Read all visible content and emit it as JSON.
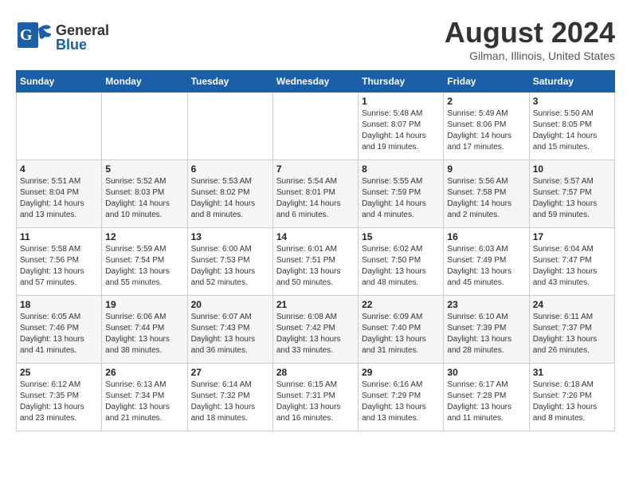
{
  "header": {
    "logo_general": "General",
    "logo_blue": "Blue",
    "month_title": "August 2024",
    "location": "Gilman, Illinois, United States"
  },
  "weekdays": [
    "Sunday",
    "Monday",
    "Tuesday",
    "Wednesday",
    "Thursday",
    "Friday",
    "Saturday"
  ],
  "weeks": [
    [
      {
        "day": "",
        "info": ""
      },
      {
        "day": "",
        "info": ""
      },
      {
        "day": "",
        "info": ""
      },
      {
        "day": "",
        "info": ""
      },
      {
        "day": "1",
        "info": "Sunrise: 5:48 AM\nSunset: 8:07 PM\nDaylight: 14 hours\nand 19 minutes."
      },
      {
        "day": "2",
        "info": "Sunrise: 5:49 AM\nSunset: 8:06 PM\nDaylight: 14 hours\nand 17 minutes."
      },
      {
        "day": "3",
        "info": "Sunrise: 5:50 AM\nSunset: 8:05 PM\nDaylight: 14 hours\nand 15 minutes."
      }
    ],
    [
      {
        "day": "4",
        "info": "Sunrise: 5:51 AM\nSunset: 8:04 PM\nDaylight: 14 hours\nand 13 minutes."
      },
      {
        "day": "5",
        "info": "Sunrise: 5:52 AM\nSunset: 8:03 PM\nDaylight: 14 hours\nand 10 minutes."
      },
      {
        "day": "6",
        "info": "Sunrise: 5:53 AM\nSunset: 8:02 PM\nDaylight: 14 hours\nand 8 minutes."
      },
      {
        "day": "7",
        "info": "Sunrise: 5:54 AM\nSunset: 8:01 PM\nDaylight: 14 hours\nand 6 minutes."
      },
      {
        "day": "8",
        "info": "Sunrise: 5:55 AM\nSunset: 7:59 PM\nDaylight: 14 hours\nand 4 minutes."
      },
      {
        "day": "9",
        "info": "Sunrise: 5:56 AM\nSunset: 7:58 PM\nDaylight: 14 hours\nand 2 minutes."
      },
      {
        "day": "10",
        "info": "Sunrise: 5:57 AM\nSunset: 7:57 PM\nDaylight: 13 hours\nand 59 minutes."
      }
    ],
    [
      {
        "day": "11",
        "info": "Sunrise: 5:58 AM\nSunset: 7:56 PM\nDaylight: 13 hours\nand 57 minutes."
      },
      {
        "day": "12",
        "info": "Sunrise: 5:59 AM\nSunset: 7:54 PM\nDaylight: 13 hours\nand 55 minutes."
      },
      {
        "day": "13",
        "info": "Sunrise: 6:00 AM\nSunset: 7:53 PM\nDaylight: 13 hours\nand 52 minutes."
      },
      {
        "day": "14",
        "info": "Sunrise: 6:01 AM\nSunset: 7:51 PM\nDaylight: 13 hours\nand 50 minutes."
      },
      {
        "day": "15",
        "info": "Sunrise: 6:02 AM\nSunset: 7:50 PM\nDaylight: 13 hours\nand 48 minutes."
      },
      {
        "day": "16",
        "info": "Sunrise: 6:03 AM\nSunset: 7:49 PM\nDaylight: 13 hours\nand 45 minutes."
      },
      {
        "day": "17",
        "info": "Sunrise: 6:04 AM\nSunset: 7:47 PM\nDaylight: 13 hours\nand 43 minutes."
      }
    ],
    [
      {
        "day": "18",
        "info": "Sunrise: 6:05 AM\nSunset: 7:46 PM\nDaylight: 13 hours\nand 41 minutes."
      },
      {
        "day": "19",
        "info": "Sunrise: 6:06 AM\nSunset: 7:44 PM\nDaylight: 13 hours\nand 38 minutes."
      },
      {
        "day": "20",
        "info": "Sunrise: 6:07 AM\nSunset: 7:43 PM\nDaylight: 13 hours\nand 36 minutes."
      },
      {
        "day": "21",
        "info": "Sunrise: 6:08 AM\nSunset: 7:42 PM\nDaylight: 13 hours\nand 33 minutes."
      },
      {
        "day": "22",
        "info": "Sunrise: 6:09 AM\nSunset: 7:40 PM\nDaylight: 13 hours\nand 31 minutes."
      },
      {
        "day": "23",
        "info": "Sunrise: 6:10 AM\nSunset: 7:39 PM\nDaylight: 13 hours\nand 28 minutes."
      },
      {
        "day": "24",
        "info": "Sunrise: 6:11 AM\nSunset: 7:37 PM\nDaylight: 13 hours\nand 26 minutes."
      }
    ],
    [
      {
        "day": "25",
        "info": "Sunrise: 6:12 AM\nSunset: 7:35 PM\nDaylight: 13 hours\nand 23 minutes."
      },
      {
        "day": "26",
        "info": "Sunrise: 6:13 AM\nSunset: 7:34 PM\nDaylight: 13 hours\nand 21 minutes."
      },
      {
        "day": "27",
        "info": "Sunrise: 6:14 AM\nSunset: 7:32 PM\nDaylight: 13 hours\nand 18 minutes."
      },
      {
        "day": "28",
        "info": "Sunrise: 6:15 AM\nSunset: 7:31 PM\nDaylight: 13 hours\nand 16 minutes."
      },
      {
        "day": "29",
        "info": "Sunrise: 6:16 AM\nSunset: 7:29 PM\nDaylight: 13 hours\nand 13 minutes."
      },
      {
        "day": "30",
        "info": "Sunrise: 6:17 AM\nSunset: 7:28 PM\nDaylight: 13 hours\nand 11 minutes."
      },
      {
        "day": "31",
        "info": "Sunrise: 6:18 AM\nSunset: 7:26 PM\nDaylight: 13 hours\nand 8 minutes."
      }
    ]
  ]
}
